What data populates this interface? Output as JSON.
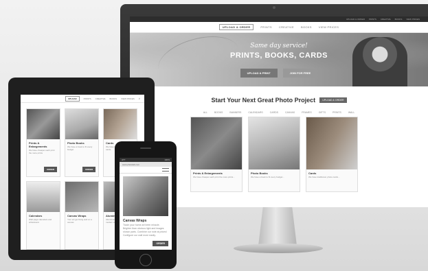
{
  "monitor": {
    "topbar": [
      "UPLOAD & ORDER",
      "PRINTS",
      "CREATIVE",
      "BOOKS",
      "VIEW PRICES"
    ],
    "nav": {
      "cta": "UPLOAD & ORDER",
      "items": [
        "PRINTS",
        "CREATIVE",
        "BOOKS",
        "VIEW PRICES"
      ]
    },
    "hero": {
      "subtitle": "Same day service!",
      "title": "PRINTS, BOOKS, CARDS",
      "buttons": [
        "UPLOAD & PRINT",
        "JOIN FOR FREE"
      ]
    },
    "section": {
      "title": "Start Your Next Great Photo Project",
      "badge": "UPLOAD & ORDER"
    },
    "filters": [
      "ALL",
      "BOOKS",
      "BANNERS",
      "CALENDARS",
      "CARDS",
      "CANVAS",
      "FRAMES",
      "GIFTS",
      "PRINTS",
      "WALL"
    ],
    "cards": [
      {
        "title": "Prints & Enlargements",
        "desc": "We have cheaper each print the more prints..."
      },
      {
        "title": "Photo Books",
        "desc": "We have a book to fit every budget..."
      },
      {
        "title": "Cards",
        "desc": "We have traditional, photo cards..."
      }
    ]
  },
  "tablet": {
    "nav": {
      "cta": "UPLOAD",
      "items": [
        "PRINTS",
        "CREATIVE",
        "BOOKS",
        "VIEW PRICES"
      ]
    },
    "cards": [
      {
        "title": "Prints & Enlargements",
        "desc": "We have cheaper each print the more prints",
        "order": "ORDER"
      },
      {
        "title": "Photo Books",
        "desc": "We have a book to fit every budget",
        "order": "ORDER"
      },
      {
        "title": "Cards",
        "desc": "We have traditional photo cards",
        "order": ""
      },
      {
        "title": "Calendars",
        "desc": "Wall-page calendars and whiteboard",
        "order": ""
      },
      {
        "title": "Canvas Wraps",
        "desc": "Your art get living well on a canvas",
        "order": ""
      },
      {
        "title": "Aluminum Prints",
        "desc": "Aluminium prints have a modern look",
        "order": ""
      }
    ]
  },
  "phone": {
    "status": {
      "left": "ATT",
      "right": "100%"
    },
    "url": "www.photolab.com",
    "card": {
      "title": "Canvas Wraps",
      "desc": "Trade your home art been miracle. Brighter than obvious light and images shown parts. Combine our note at prices! Configure our wall more easily.",
      "order": "ORDER"
    }
  }
}
